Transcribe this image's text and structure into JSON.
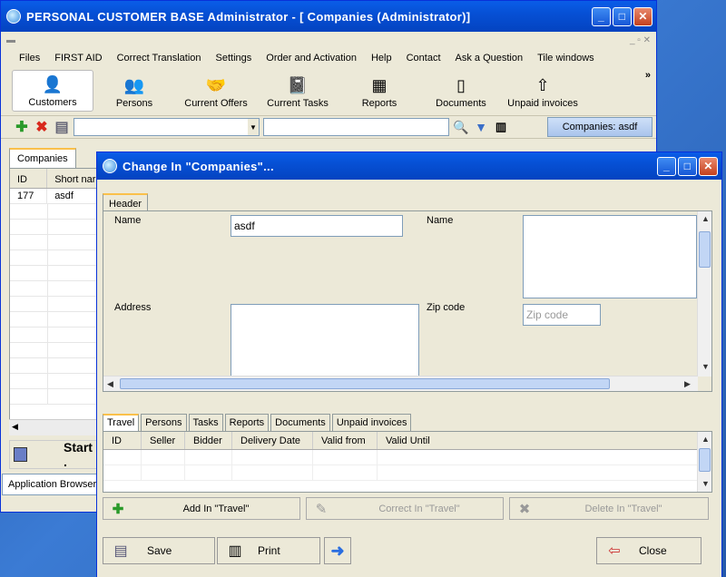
{
  "main_window": {
    "title": "PERSONAL CUSTOMER BASE  Administrator - [      Companies (Administrator)]",
    "menu": [
      "Files",
      "FIRST AID",
      "Correct Translation",
      "Settings",
      "Order and Activation",
      "Help",
      "Contact",
      "Ask a Question",
      "Tile windows"
    ],
    "toolbar": [
      "Customers",
      "Persons",
      "Current Offers",
      "Current Tasks",
      "Reports",
      "Documents",
      "Unpaid invoices"
    ],
    "more": "»",
    "companies_button": "Companies: asdf",
    "tab": "Companies",
    "columns": [
      "ID",
      "Short nar"
    ],
    "rows": [
      [
        "177",
        "asdf"
      ]
    ],
    "start_label": "Start .",
    "app_browser": "Application Browser"
  },
  "dialog": {
    "title": "Change  In \"Companies\"...",
    "header_tab": "Header",
    "name_label": "Name",
    "name_value": "asdf",
    "name2_label": "Name",
    "address_label": "Address",
    "zip_label": "Zip code",
    "zip_placeholder": "Zip code",
    "tabs": [
      "Travel",
      "Persons",
      "Tasks",
      "Reports",
      "Documents",
      "Unpaid invoices"
    ],
    "columns": [
      "ID",
      "Seller",
      "Bidder",
      "Delivery Date",
      "Valid from",
      "Valid Until"
    ],
    "add_label": "Add  In \"Travel\"",
    "correct_label": "Correct  In \"Travel\"",
    "delete_label": "Delete  In \"Travel\"",
    "save_label": "Save",
    "print_label": "Print",
    "close_label": "Close"
  }
}
